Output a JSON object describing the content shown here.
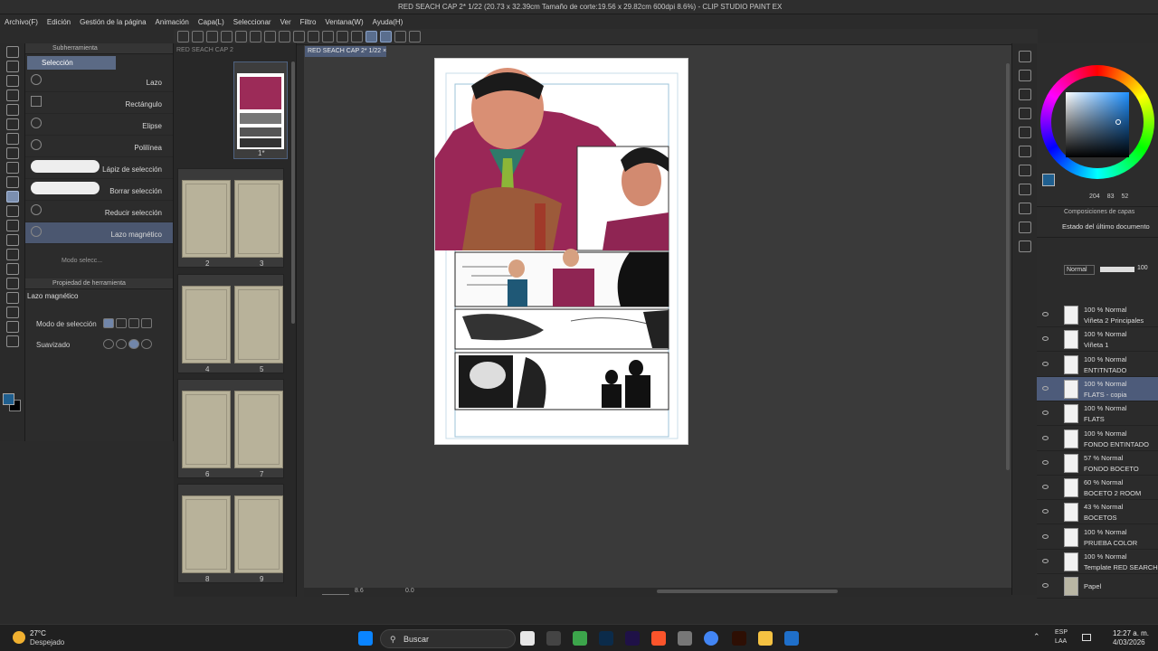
{
  "app": {
    "title": "RED SEACH CAP 2* 1/22 (20.73 x 32.39cm Tamaño de corte:19.56 x 29.82cm 600dpi 8.6%) - CLIP STUDIO PAINT EX"
  },
  "menu": [
    "Archivo(F)",
    "Edición",
    "Gestión de la página",
    "Animación",
    "Capa(L)",
    "Seleccionar",
    "Ver",
    "Filtro",
    "Ventana(W)",
    "Ayuda(H)"
  ],
  "subtool": {
    "panel_title": "Subherramienta",
    "group_label": "Selección",
    "items": [
      "Lazo",
      "Rectángulo",
      "Elipse",
      "Polilínea",
      "Lápiz de selección",
      "Borrar selección",
      "Reducir selección",
      "Lazo magnético"
    ],
    "cutoff_item": "Modo selecc..."
  },
  "tool_property": {
    "panel_title": "Propiedad de herramienta",
    "tool_name": "Lazo magnético",
    "mode_label": "Modo de selección",
    "smoothing_label": "Suavizado"
  },
  "pages_panel": {
    "tab_label": "RED SEACH CAP 2",
    "first_page": "1*",
    "pages": [
      "2",
      "3",
      "4",
      "5",
      "6",
      "7",
      "8",
      "9"
    ]
  },
  "canvas": {
    "tab_label": "RED SEACH CAP 2* 1/22 ×",
    "zoom": "8.6",
    "rotation": "0.0"
  },
  "color": {
    "main_hex": "#1f5f8f",
    "sub_hex": "#000000",
    "values": [
      "204",
      "83",
      "52"
    ]
  },
  "layer_comp": {
    "panel_title": "Composiciones de capas",
    "item": "Estado del último documento"
  },
  "layers": {
    "blend_mode": "Normal",
    "opacity": "100",
    "items": [
      {
        "prop": "100 % Normal",
        "name": "Viñeta 2 Principales",
        "selected": false
      },
      {
        "prop": "100 % Normal",
        "name": "Viñeta 1",
        "selected": false
      },
      {
        "prop": "100 % Normal",
        "name": "ENTITNTADO",
        "selected": false
      },
      {
        "prop": "100 % Normal",
        "name": "FLATS - copia",
        "selected": true
      },
      {
        "prop": "100 % Normal",
        "name": "FLATS",
        "selected": false
      },
      {
        "prop": "100 % Normal",
        "name": "FONDO ENTINTADO",
        "selected": false
      },
      {
        "prop": "57 % Normal",
        "name": "FONDO BOCETO",
        "selected": false
      },
      {
        "prop": "60 % Normal",
        "name": "BOCETO 2 ROOM",
        "selected": false
      },
      {
        "prop": "43 % Normal",
        "name": "BOCETOS",
        "selected": false
      },
      {
        "prop": "100 % Normal",
        "name": "PRUEBA COLOR",
        "selected": false
      },
      {
        "prop": "100 % Normal",
        "name": "Template RED SEARCH - co",
        "selected": false
      },
      {
        "prop": "",
        "name": "Papel",
        "selected": false
      }
    ]
  },
  "taskbar": {
    "weather_temp": "27°C",
    "weather_desc": "Despejado",
    "search_label": "Buscar",
    "lang_1": "ESP",
    "lang_2": "LAA",
    "time": "12:27 a. m.",
    "date": "4/03/2026"
  }
}
